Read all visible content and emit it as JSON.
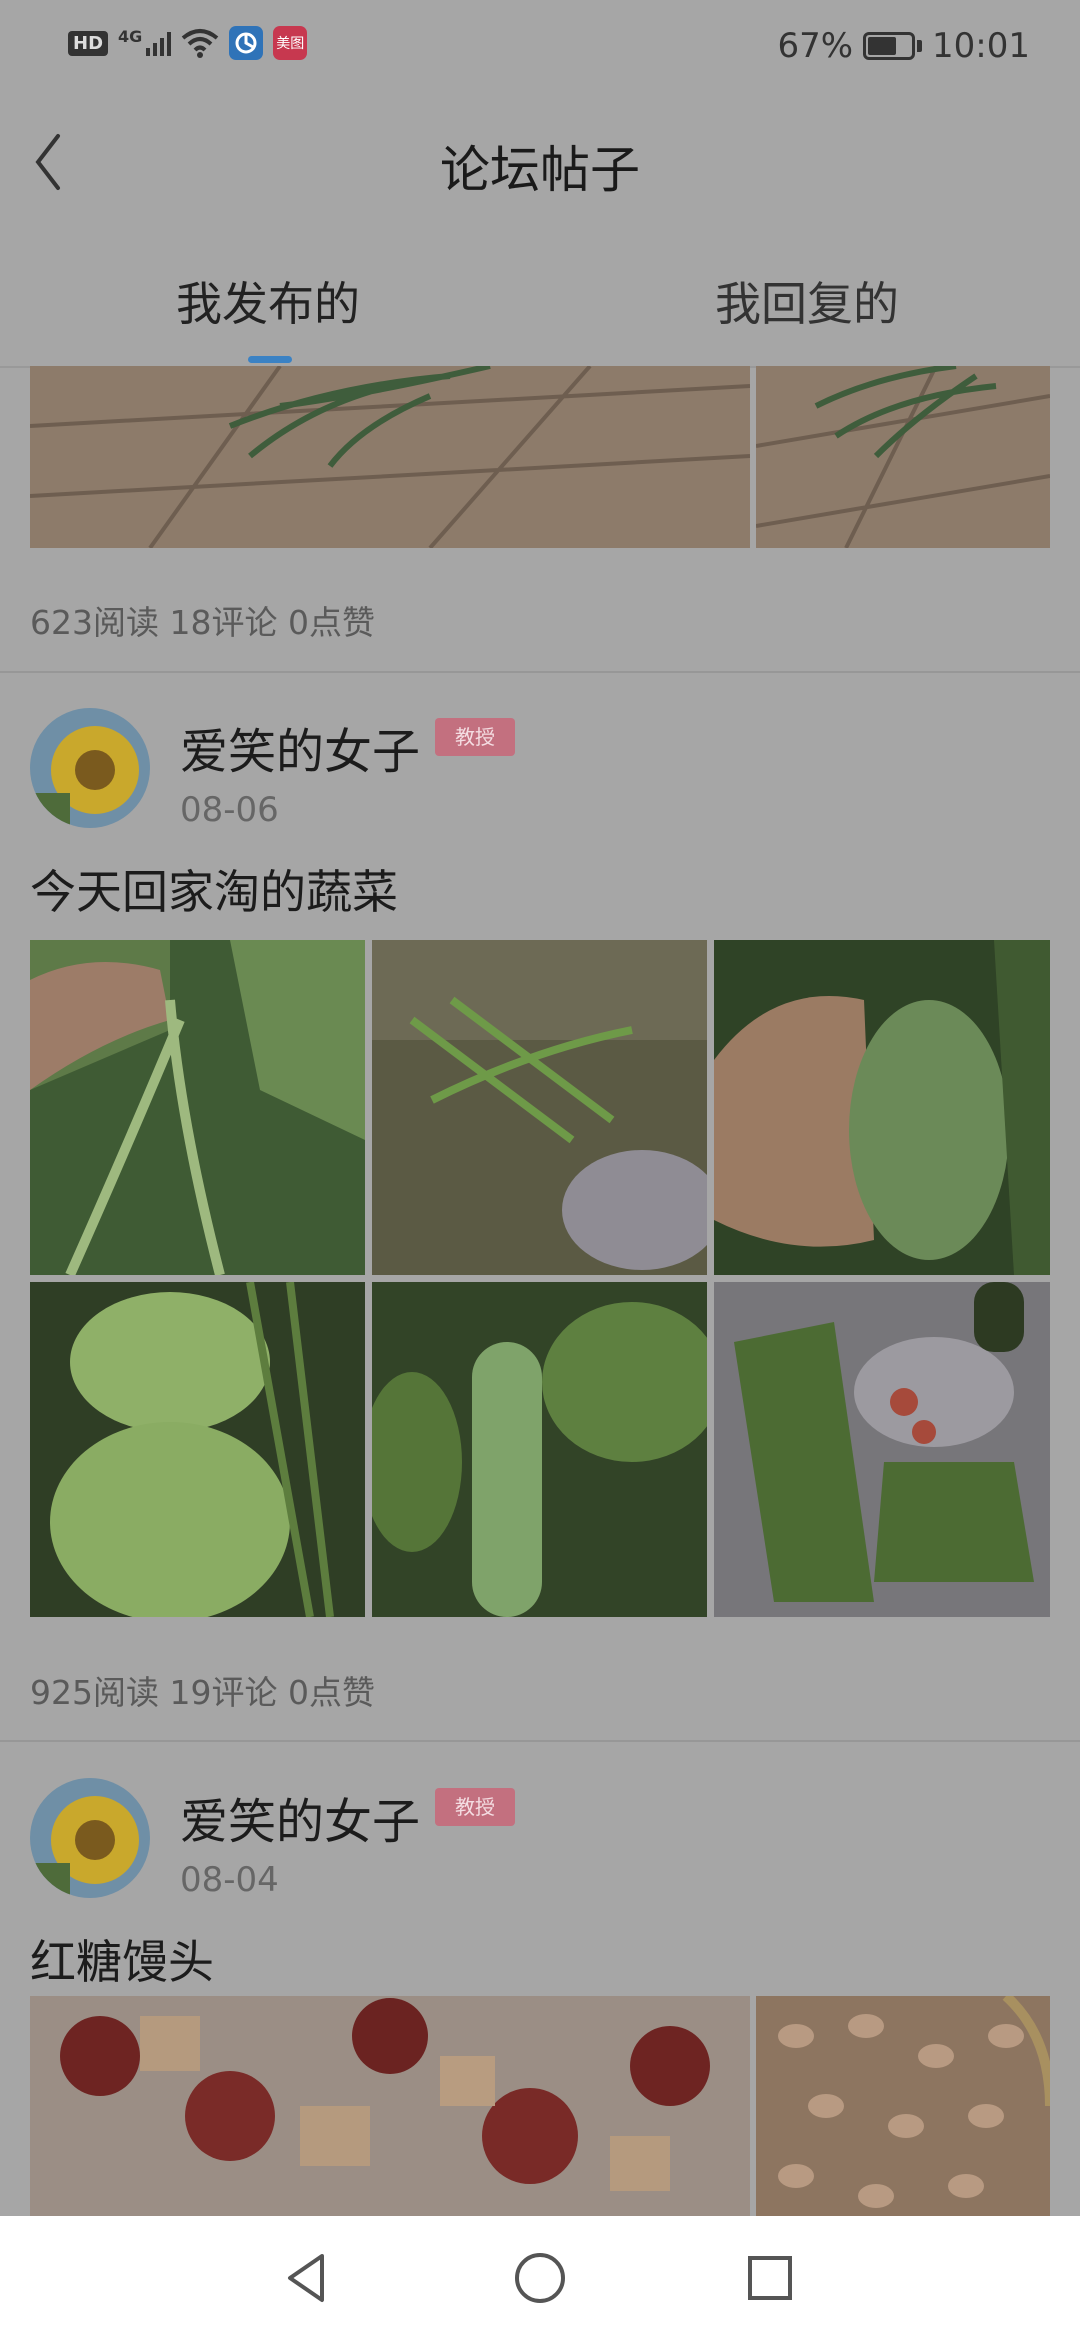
{
  "status_bar": {
    "hd": "HD",
    "network": "4G",
    "app_icon_2_label": "美图",
    "battery_percent_text": "67%",
    "battery_level": 0.67,
    "time": "10:01"
  },
  "header": {
    "title": "论坛帖子"
  },
  "tabs": [
    {
      "label": "我发布的",
      "selected": true
    },
    {
      "label": "我回复的",
      "selected": false
    }
  ],
  "posts": [
    {
      "stats": "623阅读 18评论 0点赞",
      "images": [
        "wood-plank-grass-photo",
        "wood-plank-grass-photo"
      ]
    },
    {
      "author": "爱笑的女子",
      "role": "教授",
      "date": "08-06",
      "title": "今天回家淘的蔬菜",
      "images": [
        "hand-holding-pea-shoots",
        "wild-greens-on-ground",
        "hand-with-winter-melon",
        "chayote-fruits",
        "loofah-in-garden",
        "vegetables-on-floor"
      ],
      "stats": "925阅读 19评论 0点赞"
    },
    {
      "author": "爱笑的女子",
      "role": "教授",
      "date": "08-04",
      "title": "红糖馒头",
      "images": [
        "red-dates-and-nuts",
        "peanuts-in-basket"
      ]
    }
  ],
  "colors": {
    "tab_indicator": "#3b82c4",
    "role_badge": "#c3707f",
    "dim_background": "#a6a6a6"
  }
}
